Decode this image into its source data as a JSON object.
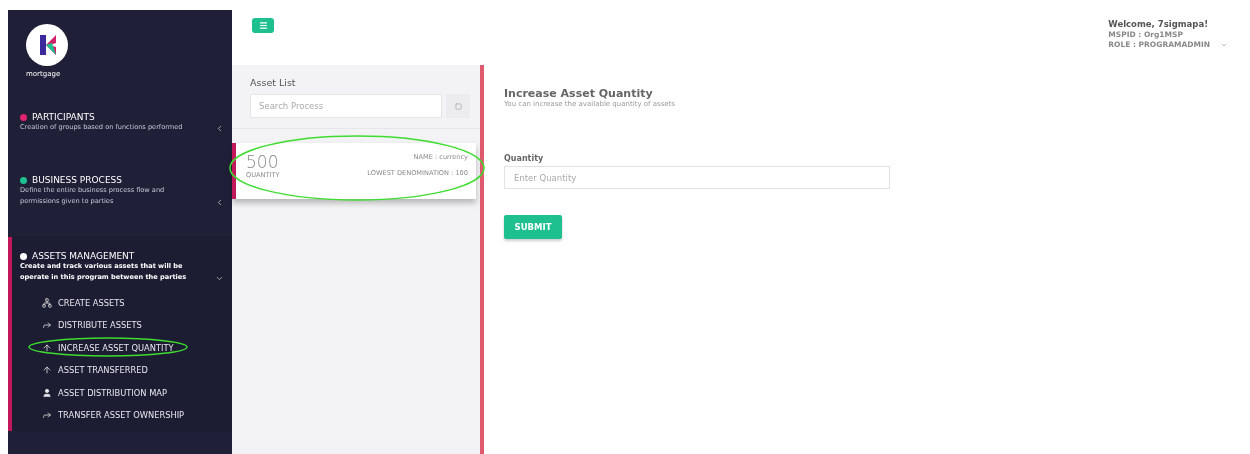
{
  "brand": {
    "name": "mortgage"
  },
  "sidebar": {
    "sections": [
      {
        "title": "PARTICIPANTS",
        "description": "Creation of groups based on functions performed",
        "color": "#e0246f",
        "expanded": false,
        "selected": false
      },
      {
        "title": "BUSINESS PROCESS",
        "description": "Define the entire business process flow and permissions given to parties",
        "color": "#1ec08f",
        "expanded": false,
        "selected": false
      },
      {
        "title": "ASSETS MANAGEMENT",
        "description": "Create and track various assets that will be operate in this program between the parties",
        "color": "#ffffff",
        "expanded": true,
        "selected": true,
        "children": [
          {
            "label": "CREATE ASSETS",
            "kind": "cluster",
            "highlighted": false
          },
          {
            "label": "DISTRIBUTE ASSETS",
            "kind": "share",
            "highlighted": false
          },
          {
            "label": "INCREASE ASSET QUANTITY",
            "kind": "up",
            "highlighted": true
          },
          {
            "label": "ASSET TRANSFERRED",
            "kind": "up",
            "highlighted": false
          },
          {
            "label": "ASSET DISTRIBUTION MAP",
            "kind": "user",
            "highlighted": false
          },
          {
            "label": "TRANSFER ASSET OWNERSHIP",
            "kind": "share",
            "highlighted": false
          }
        ]
      }
    ]
  },
  "header": {
    "welcome": "Welcome, 7sigmapa!",
    "mspid": "MSPID : Org1MSP",
    "role": "ROLE : PROGRAMADMIN"
  },
  "asset_list": {
    "title": "Asset List",
    "search": {
      "placeholder": "Search Process"
    },
    "items": [
      {
        "quantity": "500",
        "quantity_label": "QUANTITY",
        "name": "NAME : currency",
        "denomination": "LOWEST DENOMINATION : 100",
        "selected": true,
        "highlighted": true
      }
    ]
  },
  "form": {
    "title": "Increase Asset Quantity",
    "subtitle": "You can increase the available quantity of assets",
    "field_label": "Quantity",
    "placeholder": "Enter Quantity",
    "submit": "SUBMIT"
  }
}
